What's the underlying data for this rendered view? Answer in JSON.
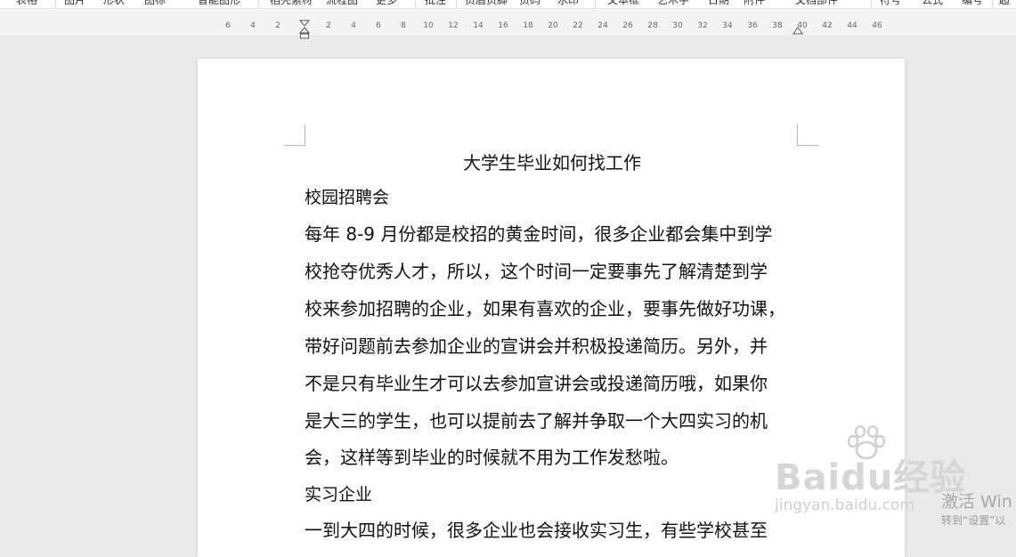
{
  "toolbar": {
    "items": [
      "表格",
      "图片",
      "形状",
      "图标",
      "智能图形",
      "稻壳素材",
      "流程图",
      "更多",
      "批注",
      "页眉页脚",
      "页码",
      "水印",
      "文本框",
      "艺术字",
      "日期",
      "附件",
      "文档部件",
      "符号",
      "公式",
      "编号",
      "超"
    ]
  },
  "ruler": {
    "ticks": [
      "6",
      "4",
      "2",
      "2",
      "4",
      "6",
      "8",
      "10",
      "12",
      "14",
      "16",
      "18",
      "20",
      "22",
      "24",
      "26",
      "28",
      "30",
      "32",
      "34",
      "36",
      "38",
      "40",
      "42",
      "44",
      "46"
    ]
  },
  "document": {
    "title": "大学生毕业如何找工作",
    "heading1": "校园招聘会",
    "paragraph1_lines": [
      "每年 8-9 月份都是校招的黄金时间，很多企业都会集中到学",
      "校抢夺优秀人才，所以，这个时间一定要事先了解清楚到学",
      "校来参加招聘的企业，如果有喜欢的企业，要事先做好功课，",
      "带好问题前去参加企业的宣讲会并积极投递简历。另外，并",
      "不是只有毕业生才可以去参加宣讲会或投递简历哦，如果你",
      "是大三的学生，也可以提前去了解并争取一个大四实习的机",
      "会，这样等到毕业的时候就不用为工作发愁啦。"
    ],
    "heading2": "实习企业",
    "paragraph2_line": "一到大四的时候，很多企业也会接收实习生，有些学校甚至"
  },
  "watermark": {
    "logo": "Baidu经验",
    "url": "jingyan.baidu.com"
  },
  "activation": {
    "line1": "激活 Win",
    "line2": "转到“设置”以"
  }
}
